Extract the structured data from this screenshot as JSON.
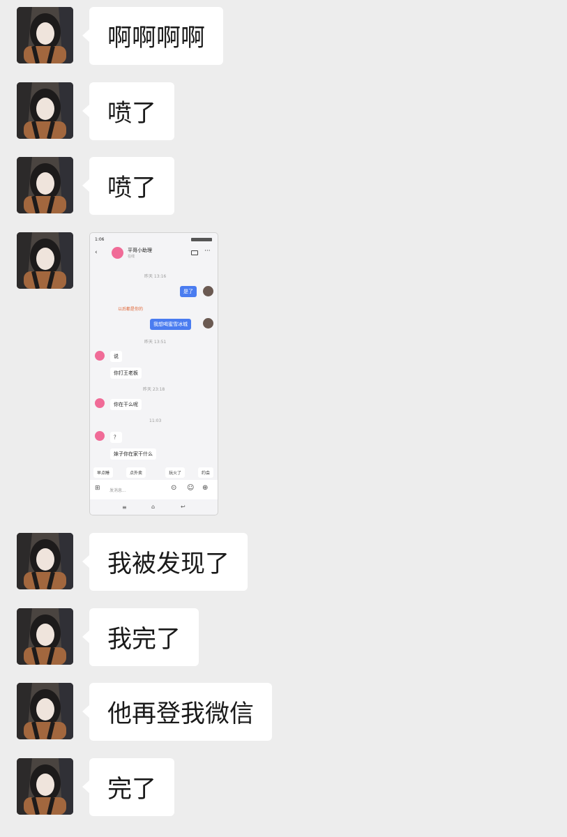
{
  "messages": [
    {
      "type": "text",
      "text": "啊啊啊啊"
    },
    {
      "type": "text",
      "text": "喷了"
    },
    {
      "type": "text",
      "text": "喷了"
    },
    {
      "type": "image"
    },
    {
      "type": "text",
      "text": "我被发现了"
    },
    {
      "type": "text",
      "text": "我完了"
    },
    {
      "type": "text",
      "text": "他再登我微信"
    },
    {
      "type": "text",
      "text": "完了"
    }
  ],
  "embedded_screenshot": {
    "status_time": "1:06",
    "contact_name": "平哥小助理",
    "contact_sub": "在线",
    "time_1": "昨天 13:16",
    "sent_1": "是了",
    "notice": "以后都是你的",
    "sent_2": "我想喝蜜雪冰城",
    "time_2": "昨天 13:51",
    "recv_1": "说",
    "recv_2": "你打王老板",
    "time_3": "昨天 23:18",
    "recv_3": "你在干么呢",
    "time_4": "11:03",
    "recv_4": "？",
    "recv_5": "妹子你在家干什么",
    "quick_1": "早点睡",
    "quick_2": "点外卖",
    "quick_3": "玩火了",
    "quick_4": "约会",
    "input_placeholder": "发消息..."
  },
  "colors": {
    "background": "#ededed",
    "bubble": "#ffffff",
    "embedded_accent": "#4a7cf0"
  }
}
